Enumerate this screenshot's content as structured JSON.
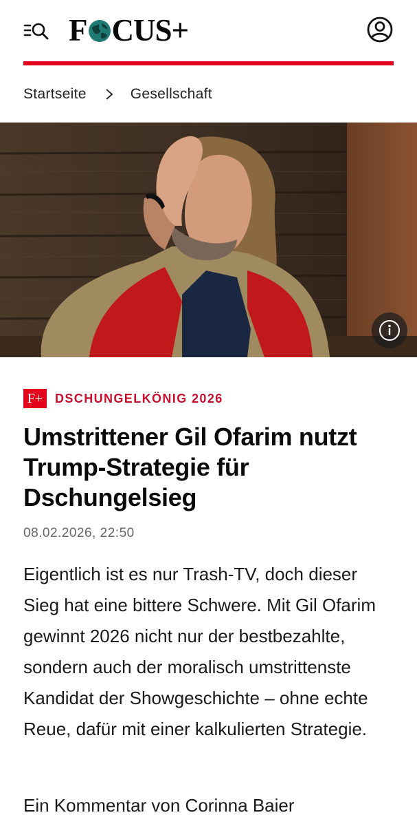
{
  "header": {
    "menu_icon": "menu-search-icon",
    "logo_text_left": "F",
    "logo_text_right": "CUS+",
    "account_icon": "user-icon",
    "accent_color": "#e3051b"
  },
  "breadcrumb": {
    "items": [
      "Startseite",
      "Gesellschaft"
    ],
    "separator_icon": "chevron-right-icon"
  },
  "hero": {
    "info_icon": "info-icon"
  },
  "article": {
    "badge": "F+",
    "kicker": "DSCHUNGELKÖNIG 2026",
    "title": "Umstrittener Gil Ofarim nutzt Trump-Strategie für Dschungelsieg",
    "date": "08.02.2026, 22:50",
    "teaser": "Eigentlich ist es nur Trash-TV, doch dieser Sieg hat eine bittere Schwere. Mit Gil Ofarim gewinnt 2026 nicht nur der bestbezahlte, sondern auch der moralisch umstrittenste Kandidat der Showgeschichte – ohne echte Reue, dafür mit einer kalkulierten Strategie.",
    "author_line": "Ein Kommentar von Corinna Baier"
  }
}
